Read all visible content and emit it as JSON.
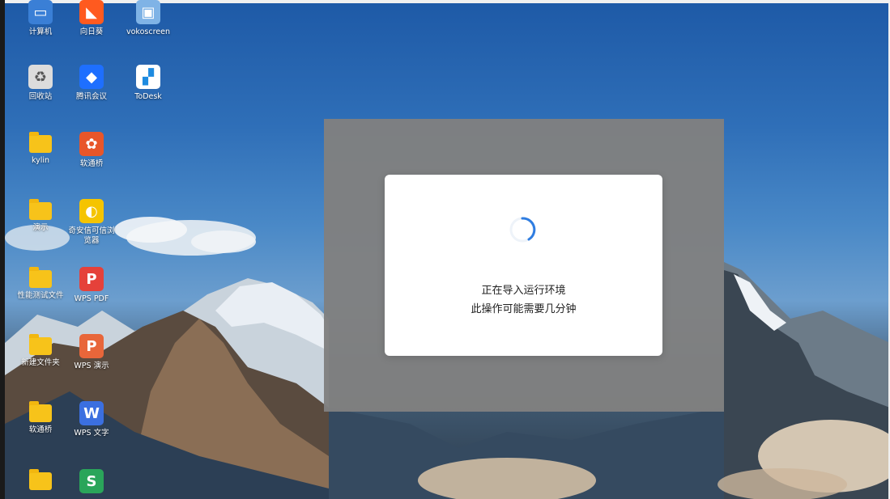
{
  "desktop": {
    "icons": [
      {
        "label": "计算机",
        "icon": "computer-icon",
        "color": "#3a7fd6"
      },
      {
        "label": "向日葵",
        "icon": "sunflower-icon",
        "color": "#ff5a1f"
      },
      {
        "label": "vokoscreen",
        "icon": "vokoscreen-icon",
        "color": "#7fb3e6"
      },
      {
        "label": "回收站",
        "icon": "trash-icon",
        "color": "#dcdcdc"
      },
      {
        "label": "腾讯会议",
        "icon": "tencent-meeting-icon",
        "color": "#1e6fff"
      },
      {
        "label": "ToDesk",
        "icon": "todesk-icon",
        "color": "#ffffff"
      },
      {
        "label": "kylin",
        "icon": "folder-icon",
        "color": "#f7c31a"
      },
      {
        "label": "软通桥",
        "icon": "ruantongqiao-icon",
        "color": "#e8562a"
      },
      {
        "label": "演示",
        "icon": "folder-icon",
        "color": "#f7c31a"
      },
      {
        "label": "奇安信可信浏览器",
        "icon": "browser-icon",
        "color": "#f5c400"
      },
      {
        "label": "性能测试文件",
        "icon": "folder-icon",
        "color": "#f7c31a"
      },
      {
        "label": "WPS PDF",
        "icon": "wps-pdf-icon",
        "color": "#e5413a"
      },
      {
        "label": "新建文件夹",
        "icon": "folder-icon",
        "color": "#f7c31a"
      },
      {
        "label": "WPS 演示",
        "icon": "wps-presentation-icon",
        "color": "#e8663a"
      },
      {
        "label": "软通桥",
        "icon": "folder-icon",
        "color": "#f7c31a"
      },
      {
        "label": "WPS 文字",
        "icon": "wps-writer-icon",
        "color": "#3b6fe0"
      },
      {
        "label": "",
        "icon": "folder-icon",
        "color": "#f7c31a"
      },
      {
        "label": "",
        "icon": "wps-spreadsheet-icon",
        "color": "#2aa55a"
      }
    ]
  },
  "dialog": {
    "line1": "正在导入运行环境",
    "line2": "此操作可能需要几分钟",
    "spinner_color": "#2f7de1"
  }
}
